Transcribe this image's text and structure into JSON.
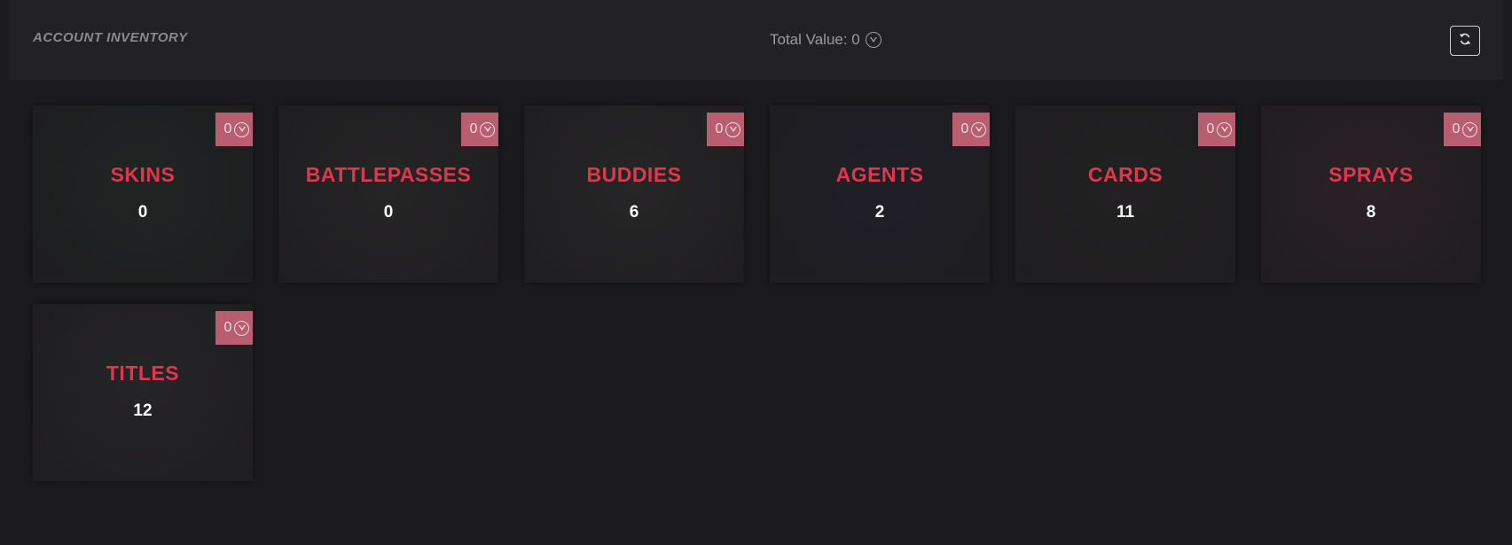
{
  "header": {
    "title": "ACCOUNT INVENTORY",
    "total_label": "Total Value: 0",
    "refresh_icon": "refresh-icon"
  },
  "currency_icon": "valorant-points-icon",
  "colors": {
    "background": "#1b1a1c",
    "header": "#222123",
    "accent": "#e0374b",
    "badge": "#b85e70"
  },
  "categories": [
    {
      "name": "SKINS",
      "count": "0",
      "value": "0",
      "bg": "#1f2523"
    },
    {
      "name": "BATTLEPASSES",
      "count": "0",
      "value": "0",
      "bg": "#262526"
    },
    {
      "name": "BUDDIES",
      "count": "6",
      "value": "0",
      "bg": "#272627"
    },
    {
      "name": "AGENTS",
      "count": "2",
      "value": "0",
      "bg": "#201f28"
    },
    {
      "name": "CARDS",
      "count": "11",
      "value": "0",
      "bg": "#222122"
    },
    {
      "name": "SPRAYS",
      "count": "8",
      "value": "0",
      "bg": "#2b2126"
    },
    {
      "name": "TITLES",
      "count": "12",
      "value": "0",
      "bg": "#252426"
    }
  ]
}
